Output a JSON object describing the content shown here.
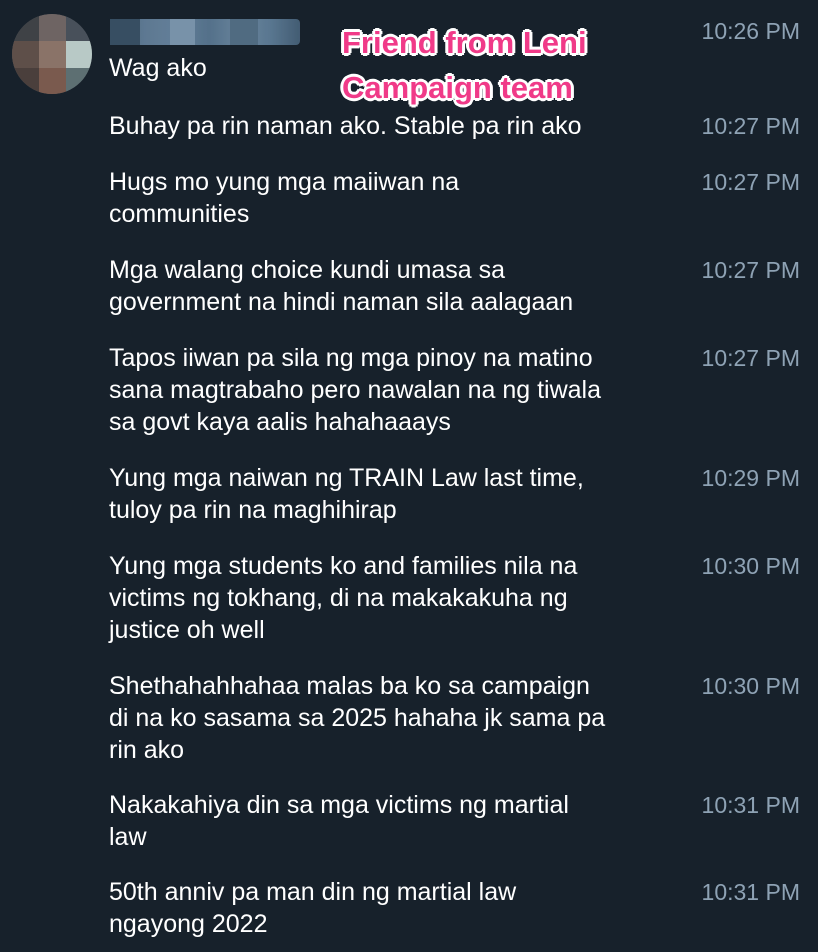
{
  "annotation": {
    "text": "Friend from Leni\nCampaign team"
  },
  "messages": [
    {
      "text": "Wag ako",
      "time": "10:26 PM"
    },
    {
      "text": "Buhay pa rin naman ako. Stable pa rin ako",
      "time": "10:27 PM"
    },
    {
      "text": "Hugs mo yung mga maiiwan na\ncommunities",
      "time": "10:27 PM"
    },
    {
      "text": "Mga walang choice kundi umasa sa\ngovernment na hindi naman sila aalagaan",
      "time": "10:27 PM"
    },
    {
      "text": "Tapos iiwan pa sila ng mga pinoy na matino\nsana magtrabaho pero nawalan na ng tiwala\nsa govt kaya aalis hahahaaays",
      "time": "10:27 PM"
    },
    {
      "text": "Yung mga naiwan ng TRAIN Law last time,\ntuloy pa rin na maghihirap",
      "time": "10:29 PM"
    },
    {
      "text": "Yung mga students ko and families nila na\nvictims ng tokhang, di na makakakuha ng\njustice oh well",
      "time": "10:30 PM"
    },
    {
      "text": "Shethahahhahaa malas ba ko sa campaign\ndi na ko sasama sa 2025 hahaha jk sama pa\nrin ako",
      "time": "10:30 PM"
    },
    {
      "text": "Nakakahiya din sa mga victims ng martial\nlaw",
      "time": "10:31 PM"
    },
    {
      "text": "50th anniv pa man din ng martial law\nngayong 2022",
      "time": "10:31 PM"
    }
  ],
  "colors": {
    "background": "#17212b",
    "message_text": "#ffffff",
    "timestamp": "#8ea2b4",
    "annotation": "#f03a88"
  }
}
